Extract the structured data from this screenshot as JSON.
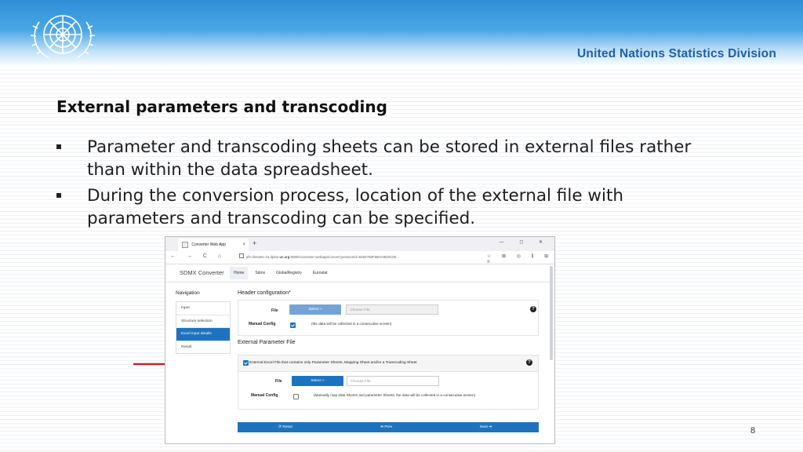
{
  "header": {
    "org_name": "United Nations Statistics Division"
  },
  "slide": {
    "title": "External parameters and transcoding",
    "bullets": [
      "Parameter and transcoding sheets can be stored in external files rather than within the data spreadsheet.",
      "During the conversion process, location of the external file with parameters and transcoding can be specified."
    ],
    "page_number": "8"
  },
  "browser": {
    "tab_title": "Converter Web App",
    "tab_close": "×",
    "new_tab": "+",
    "window_controls": "—  ◻  ✕",
    "nav_buttons": "← → C ⌂",
    "url_prefix": "sfs-dessets-16.dplos.",
    "url_domain": "un.org",
    "url_suffix": ":8080/converter-webapp/convert;jsessionid=8482789F5B4A8D0C80...",
    "right_icons": "☆ ⊠ ◎ ⫼ ⊞ ≡"
  },
  "app": {
    "brand": "SDMX Converter",
    "nav_items": [
      {
        "label": "Home",
        "active": true
      },
      {
        "label": "Sdmx",
        "active": false
      },
      {
        "label": "GlobalRegistry",
        "active": false
      },
      {
        "label": "Eurostat",
        "active": false
      }
    ],
    "navigation_heading": "Navigation",
    "navigation_items": [
      {
        "label": "Input",
        "active": false
      },
      {
        "label": "Structure selection",
        "active": false
      },
      {
        "label": "Excel input details",
        "active": true
      },
      {
        "label": "Result",
        "active": false
      }
    ],
    "header_config": {
      "title": "Header configuration*",
      "file_label": "File",
      "select_label": "Select »",
      "choose_placeholder": "Choose File",
      "manual_label": "Manual Config",
      "manual_checked": true,
      "manual_note": "(the data will be collected in a consecutive screen)"
    },
    "external": {
      "title": "External Parameter File",
      "checkbox_label": "External Excel File that contains only Parameter Sheets, Mapping Sheet and/or a Transcoding Sheet",
      "checkbox_checked": true,
      "file_label": "File",
      "select_label": "Select »",
      "choose_placeholder": "Choose File",
      "manual_label": "Manual Config",
      "manual_checked": false,
      "manual_note": "(Manually map data Sheets and parameter Sheets, the data will be collected in a consecutive screen)"
    },
    "buttons": {
      "reset": "⟳ Reset",
      "prev": "⇚ Prev",
      "next": "Next ➜"
    },
    "help_icon": "?"
  },
  "colors": {
    "accent": "#1e73be",
    "banner": "#4aa7e6",
    "arrow": "#c0262d"
  }
}
